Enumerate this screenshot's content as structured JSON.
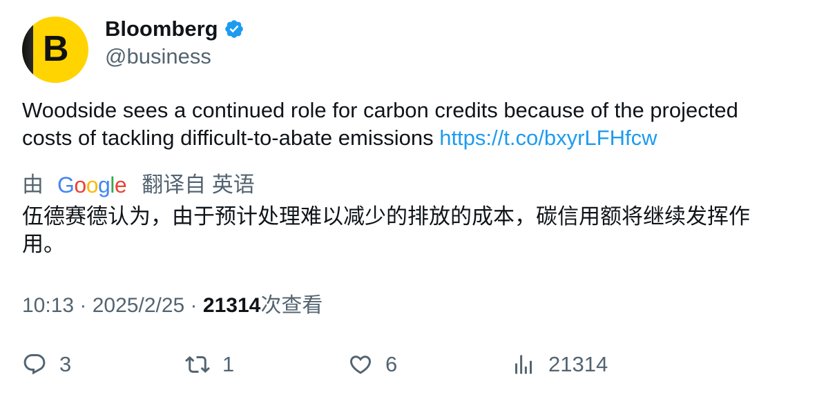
{
  "author": {
    "name": "Bloomberg",
    "handle": "@business",
    "avatar_letter": "B",
    "verified_icon": "verified-badge-icon"
  },
  "tweet": {
    "text": "Woodside sees a continued role for carbon credits because of the projected costs of tackling difficult-to-abate emissions ",
    "link": "https://t.co/bxyrLFHfcw"
  },
  "translation": {
    "prefix": "由",
    "google": [
      "G",
      "o",
      "o",
      "g",
      "l",
      "e"
    ],
    "suffix": "翻译自 英语",
    "text": "伍德赛德认为，由于预计处理难以减少的排放的成本，碳信用额将继续发挥作用。"
  },
  "meta": {
    "time": "10:13",
    "sep1": " · ",
    "date": "2025/2/25",
    "sep2": " · ",
    "views": "21314",
    "views_label": "次查看"
  },
  "actions": {
    "replies": "3",
    "retweets": "1",
    "likes": "6",
    "views": "21314"
  },
  "colors": {
    "text": "#0f1419",
    "secondary": "#536471",
    "link": "#1d9bf0",
    "avatar_bg": "#ffd400"
  }
}
